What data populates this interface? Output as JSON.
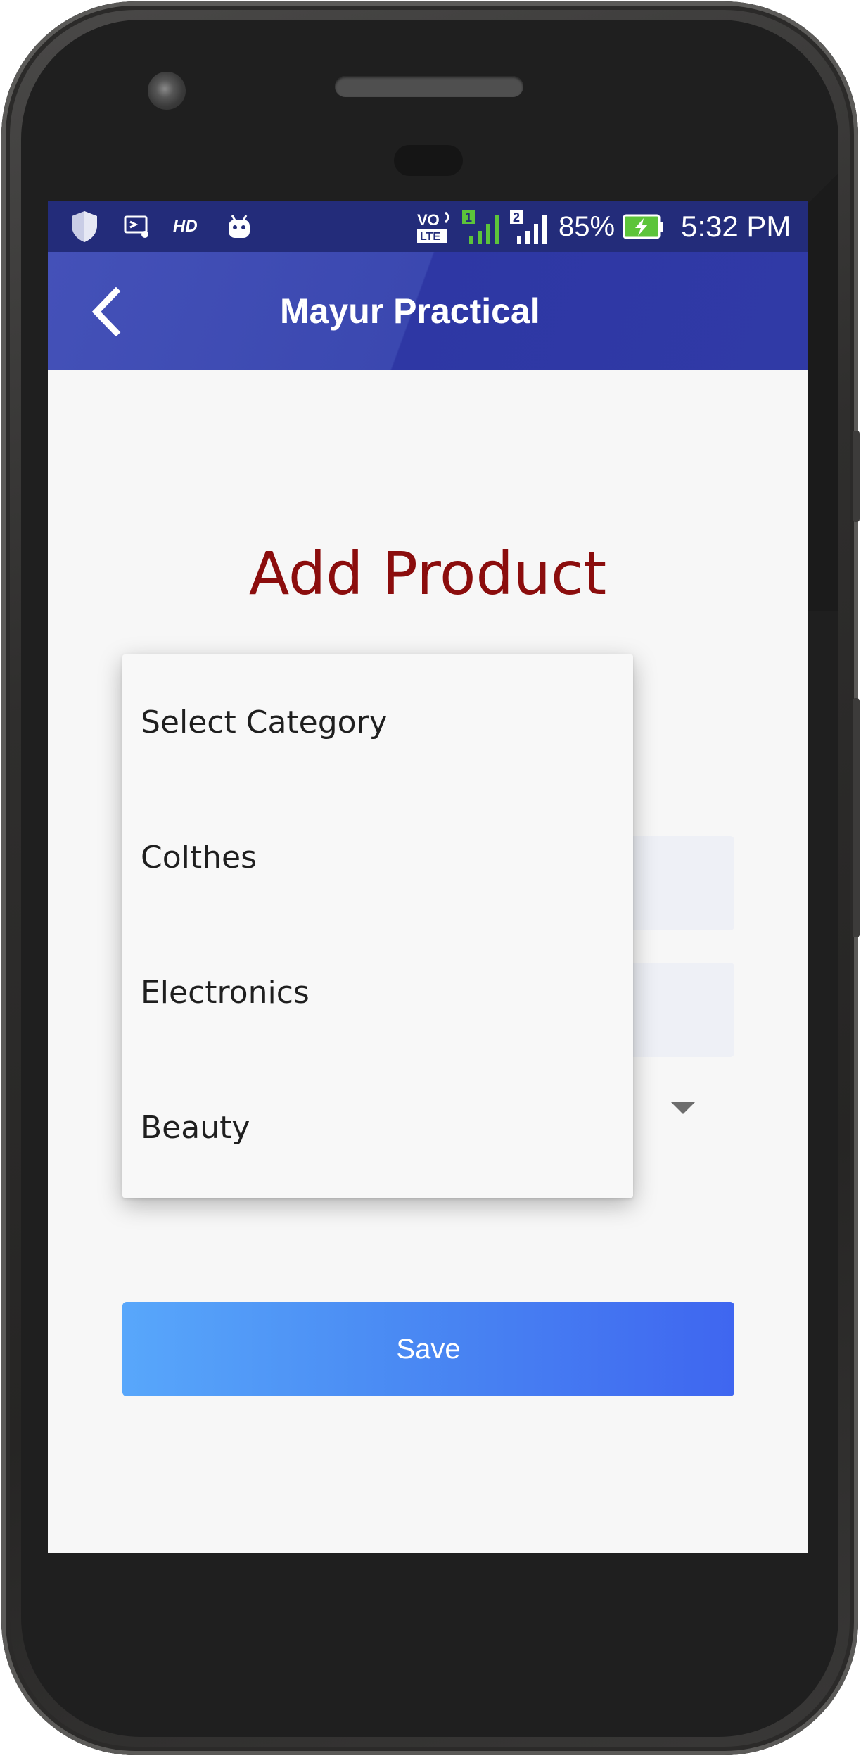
{
  "status_bar": {
    "network_label": "HD",
    "volte_label": "VO LTE",
    "sim1": "1",
    "sim2": "2",
    "battery_percent": "85%",
    "time": "5:32 PM"
  },
  "app_bar": {
    "title": "Mayur Practical"
  },
  "form": {
    "title": "Add Product",
    "save_label": "Save"
  },
  "dropdown": {
    "options": [
      "Select Category",
      "Colthes",
      "Electronics",
      "Beauty"
    ]
  },
  "colors": {
    "status_bar": "#232c7a",
    "app_bar": "#3b48b0",
    "title_text": "#8b0d0d",
    "save_start": "#58a7fb",
    "save_end": "#3f66f0"
  },
  "icons": {
    "status": [
      "shield-icon",
      "cast-icon",
      "hd-label",
      "android-icon",
      "volte-icon",
      "signal-sim1-icon",
      "signal-sim2-icon",
      "battery-charging-icon"
    ],
    "app_bar": "back-arrow-icon",
    "spinner": "dropdown-triangle-icon"
  }
}
